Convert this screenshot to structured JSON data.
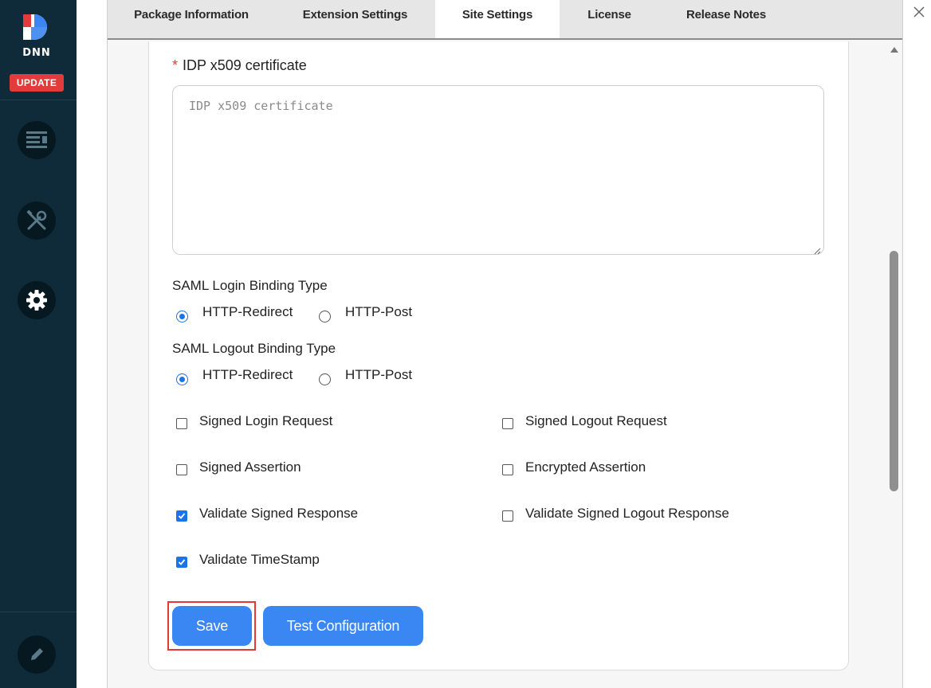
{
  "sidebar": {
    "logo_text": "DNN",
    "update_label": "UPDATE",
    "icons": [
      "content-icon",
      "tools-icon",
      "settings-gear-icon",
      "edit-pencil-icon"
    ]
  },
  "tabs": [
    {
      "label": "Package Information",
      "active": false
    },
    {
      "label": "Extension Settings",
      "active": false
    },
    {
      "label": "Site Settings",
      "active": true
    },
    {
      "label": "License",
      "active": false
    },
    {
      "label": "Release Notes",
      "active": false
    }
  ],
  "certificate": {
    "required_mark": "*",
    "label": "IDP x509 certificate",
    "placeholder": "IDP x509 certificate",
    "value": ""
  },
  "login_binding": {
    "label": "SAML Login Binding Type",
    "options": [
      "HTTP-Redirect",
      "HTTP-Post"
    ],
    "selected": "HTTP-Redirect"
  },
  "logout_binding": {
    "label": "SAML Logout Binding Type",
    "options": [
      "HTTP-Redirect",
      "HTTP-Post"
    ],
    "selected": "HTTP-Redirect"
  },
  "checkboxes": [
    {
      "label": "Signed Login Request",
      "checked": false
    },
    {
      "label": "Signed Logout Request",
      "checked": false
    },
    {
      "label": "Signed Assertion",
      "checked": false
    },
    {
      "label": "Encrypted Assertion",
      "checked": false
    },
    {
      "label": "Validate Signed Response",
      "checked": true
    },
    {
      "label": "Validate Signed Logout Response",
      "checked": false
    },
    {
      "label": "Validate TimeStamp",
      "checked": true
    }
  ],
  "buttons": {
    "save": "Save",
    "test": "Test Configuration"
  },
  "colors": {
    "sidebar": "#0f2b3a",
    "accent": "#3a86f2",
    "update_badge": "#e23b3b",
    "highlight": "#e53935"
  }
}
